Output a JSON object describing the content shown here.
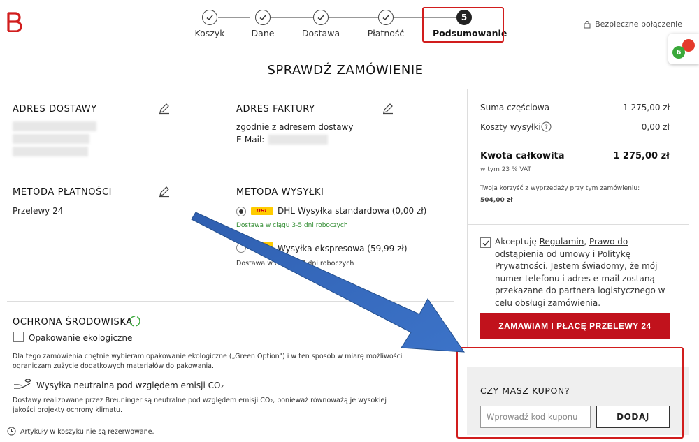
{
  "brand": {
    "logo_icon": "breuninger-b-logo-icon",
    "accent": "#c1121c",
    "highlight": "#d11d1d"
  },
  "steps": [
    {
      "label": "Koszyk",
      "state": "done"
    },
    {
      "label": "Dane",
      "state": "done"
    },
    {
      "label": "Dostawa",
      "state": "done"
    },
    {
      "label": "Płatność",
      "state": "done"
    },
    {
      "label": "Podsumowanie",
      "state": "active",
      "number": "5"
    }
  ],
  "header": {
    "secure": "Bezpieczne połączenie",
    "badge_count": "6"
  },
  "page_title": "SPRAWDŹ ZAMÓWIENIE",
  "delivery_address": {
    "title": "ADRES DOSTAWY"
  },
  "billing_address": {
    "title": "ADRES FAKTURY",
    "line1": "zgodnie z adresem dostawy",
    "email_label": "E-Mail:"
  },
  "payment": {
    "title": "METODA PŁATNOŚCI",
    "value": "Przelewy 24"
  },
  "shipping": {
    "title": "METODA WYSYŁKI",
    "options": [
      {
        "label": "DHL Wysyłka standardowa (0,00 zł)",
        "note": "Dostawa w ciągu 3-5 dni roboczych",
        "selected": true,
        "logo": "DHL"
      },
      {
        "label": "Wysyłka ekspresowa (59,99 zł)",
        "note": "Dostawa w ciągu 2-4 dni roboczych",
        "selected": false,
        "logo": "DHL"
      }
    ]
  },
  "environment": {
    "title": "OCHRONA ŚRODOWISKA",
    "eco_option": "Opakowanie ekologiczne",
    "eco_desc": "Dla tego zamówienia chętnie wybieram opakowanie ekologiczne („Green Option\") i w ten sposób w miarę możliwości ograniczam zużycie dodatkowych materiałów do pakowania.",
    "neutral_title": "Wysyłka neutralna pod względem emisji CO₂",
    "neutral_desc": "Dostawy realizowane przez Breuninger są neutralne pod względem emisji CO₂, ponieważ równoważą je wysokiej jakości projekty ochrony klimatu.",
    "reservation_note": "Artykuły w koszyku nie są rezerwowane."
  },
  "summary": {
    "subtotal_label": "Suma częściowa",
    "subtotal_value": "1 275,00 zł",
    "shipping_label": "Koszty wysyłki",
    "shipping_value": "0,00 zł",
    "total_label": "Kwota całkowita",
    "total_value": "1 275,00 zł",
    "vat_note": "w tym 23 % VAT",
    "savings_label": "Twoja korzyść z wyprzedaży przy tym zamówieniu:",
    "savings_value": "504,00 zł"
  },
  "terms": {
    "checked": true,
    "t1": "Akceptuję ",
    "link1": "Regulamin",
    "t2": ", ",
    "link2": "Prawo do odstąpienia",
    "t3": " od umowy i ",
    "link3": "Politykę Prywatności",
    "t4": ". Jestem świadomy, że mój numer telefonu i adres e-mail zostaną przekazane do partnera logistycznego w celu obsługi zamówienia."
  },
  "order_button": "ZAMAWIAM I PŁACĘ PRZELEWY 24",
  "coupon": {
    "title": "CZY MASZ KUPON?",
    "placeholder": "Wprowadź kod kuponu",
    "button": "DODAJ"
  }
}
